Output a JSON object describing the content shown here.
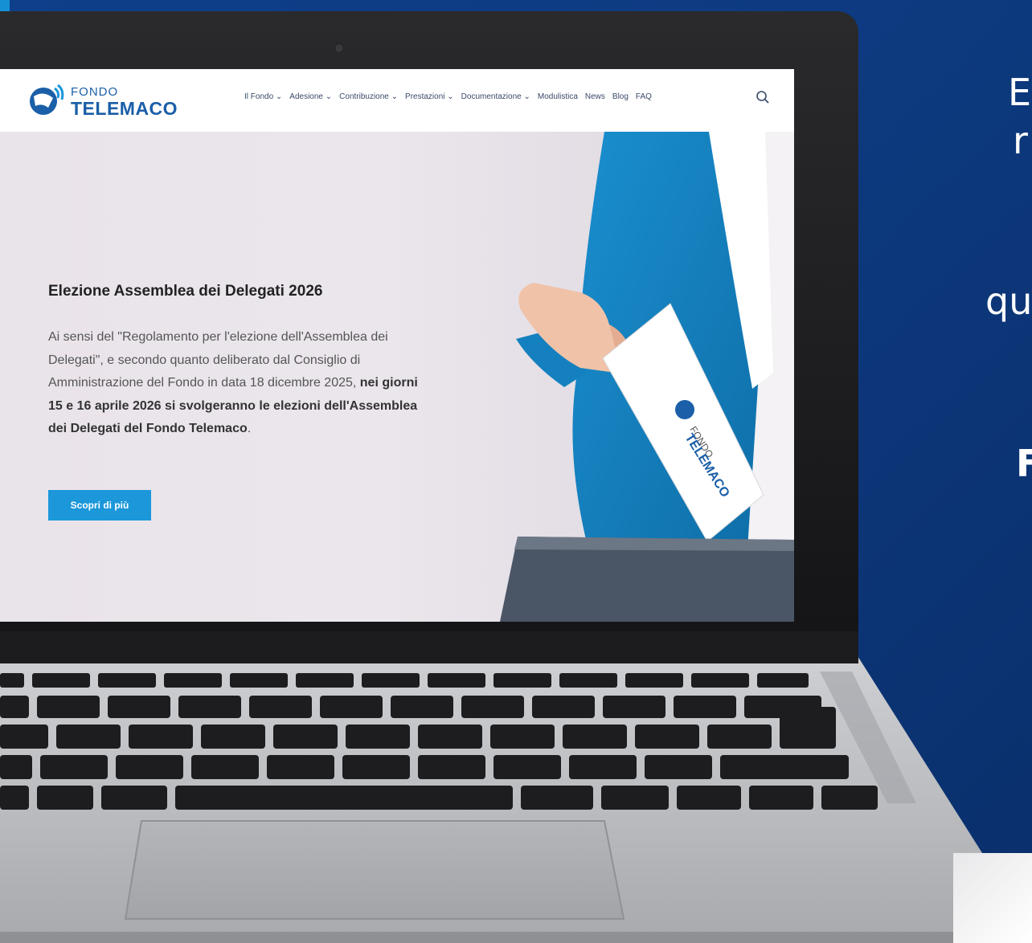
{
  "header": {
    "logo_fondo": "FONDO",
    "logo_telemaco": "TELEMACO",
    "nav": [
      "Il Fondo ⌄",
      "Adesione ⌄",
      "Contribuzione ⌄",
      "Prestazioni ⌄",
      "Documentazione ⌄",
      "Modulistica",
      "News",
      "Blog",
      "FAQ"
    ]
  },
  "hero": {
    "title": "Elezione Assemblea dei Delegati 2026",
    "para_normal_1": "Ai sensi del \"Regolamento per l'elezione dell'Assemblea dei Delegati\", e secondo quanto deliberato dal Consiglio di Amministrazione del Fondo in data 18 dicembre 2025, ",
    "para_bold": "nei giorni 15 e 16 aprile 2026 si svolgeranno le elezioni dell'Assemblea dei Delegati del Fondo Telemaco",
    "para_normal_2": ".",
    "button_label": "Scopri di più"
  },
  "ballot": {
    "fondo": "FONDO",
    "telemaco": "TELEMACO"
  },
  "side_text": {
    "line1": "E",
    "line2": "r",
    "line3": "qu",
    "line4": "F"
  },
  "colors": {
    "background": "#0d3a80",
    "accent": "#1b97da",
    "brand": "#1b5fa8"
  }
}
